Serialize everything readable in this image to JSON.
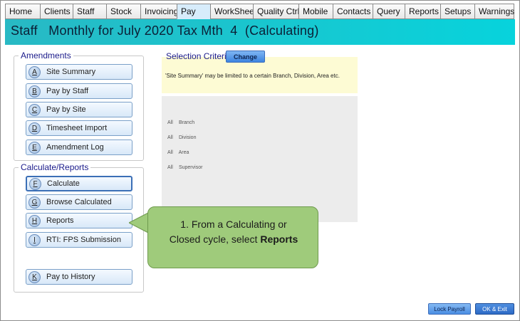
{
  "tabs": [
    "Home",
    "Clients",
    "Staff",
    "Stock",
    "Invoicing",
    "Pay",
    "WorkSheet",
    "Quality Ctrl",
    "Mobile",
    "Contacts",
    "Query",
    "Reports",
    "Setups",
    "Warnings"
  ],
  "active_tab": "Pay",
  "header": {
    "title": "Staff   Monthly for July 2020 Tax Mth  4  (Calculating)"
  },
  "amendments": {
    "label": "Amendments",
    "buttons": [
      {
        "key": "A",
        "label": "Site Summary"
      },
      {
        "key": "B",
        "label": "Pay by Staff"
      },
      {
        "key": "C",
        "label": "Pay by Site"
      },
      {
        "key": "D",
        "label": "Timesheet Import"
      },
      {
        "key": "E",
        "label": "Amendment Log"
      }
    ]
  },
  "calculate": {
    "label": "Calculate/Reports",
    "buttons": [
      {
        "key": "F",
        "label": "Calculate"
      },
      {
        "key": "G",
        "label": "Browse Calculated"
      },
      {
        "key": "H",
        "label": "Reports"
      },
      {
        "key": "I",
        "label": "RTI: FPS Submission"
      },
      {
        "key": "K",
        "label": "Pay to History"
      }
    ]
  },
  "selection": {
    "label": "Selection Criteria",
    "change_label": "Change",
    "note": "'Site Summary' may be limited to a certain Branch, Division, Area etc.",
    "rows": [
      {
        "value": "All",
        "field": "Branch"
      },
      {
        "value": "All",
        "field": "Division"
      },
      {
        "value": "All",
        "field": "Area"
      },
      {
        "value": "All",
        "field": "Supervisor"
      }
    ]
  },
  "callout": {
    "line1": "1. From a Calculating or",
    "line2_prefix": "Closed cycle, select ",
    "line2_bold": "Reports"
  },
  "footer": {
    "lock_label": "Lock Payroll",
    "ok_label": "OK & Exit"
  },
  "colors": {
    "title_band": "#19c6cf",
    "active_tab": "#d7ecfb",
    "callout": "#9fcb7b",
    "note_bg": "#fdfbd4"
  }
}
